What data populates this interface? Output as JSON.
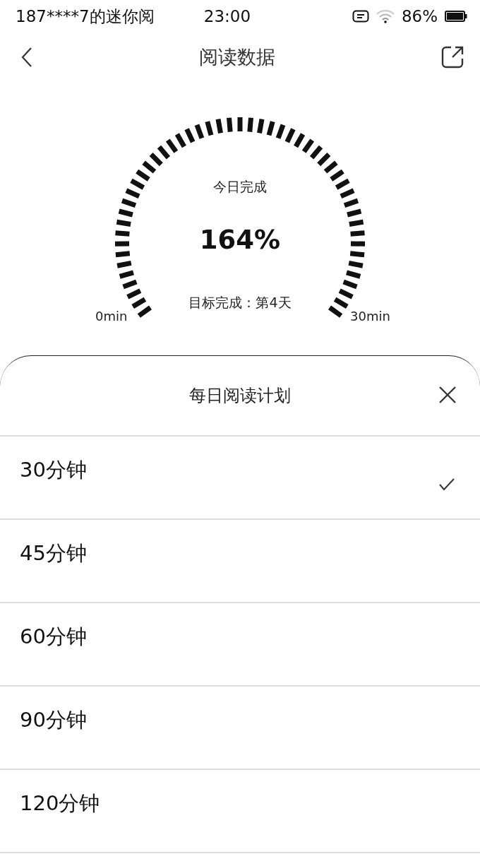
{
  "status_bar": {
    "carrier": "187****7的迷你阅",
    "time": "23:00",
    "battery": "86%"
  },
  "nav": {
    "title": "阅读数据"
  },
  "gauge": {
    "caption": "今日完成",
    "value": "164%",
    "goal": "目标完成：第4天",
    "min_label": "0min",
    "max_label": "30min"
  },
  "sheet": {
    "title": "每日阅读计划",
    "options": [
      {
        "label": "30分钟",
        "selected": true
      },
      {
        "label": "45分钟",
        "selected": false
      },
      {
        "label": "60分钟",
        "selected": false
      },
      {
        "label": "90分钟",
        "selected": false
      },
      {
        "label": "120分钟",
        "selected": false
      }
    ]
  }
}
